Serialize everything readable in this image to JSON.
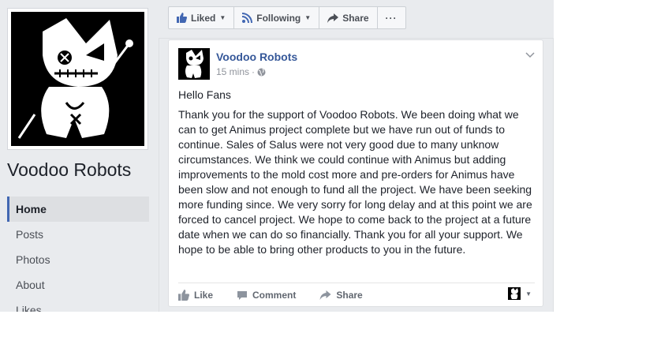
{
  "page": {
    "name": "Voodoo Robots"
  },
  "nav": {
    "items": [
      {
        "label": "Home",
        "active": true
      },
      {
        "label": "Posts",
        "active": false
      },
      {
        "label": "Photos",
        "active": false
      },
      {
        "label": "About",
        "active": false
      },
      {
        "label": "Likes",
        "active": false
      }
    ]
  },
  "actions": {
    "liked_label": "Liked",
    "following_label": "Following",
    "share_label": "Share",
    "more_icon": "ellipsis-icon"
  },
  "post": {
    "author": "Voodoo Robots",
    "time": "15 mins",
    "separator": "·",
    "audience_icon": "globe-icon",
    "greeting": "Hello Fans",
    "message": "Thank you for the support of Voodoo Robots. We been doing what we can to get Animus project complete but we have run out of funds to continue. Sales of Salus were not very good due to many unknow circumstances. We think we could continue with Animus but adding improvements to the mold cost more and pre-orders for Animus have been slow and not enough to fund all the project. We have been seeking more funding since. We very sorry for long delay and at this point we are forced to cancel project. We hope to come back to the project at a future date when we can do so financially. Thank you for all your support. We hope to be able to bring other products to you in the future.",
    "footer": {
      "like_label": "Like",
      "comment_label": "Comment",
      "share_label": "Share"
    }
  },
  "colors": {
    "link_blue": "#365899",
    "accent_blue": "#4267b2",
    "page_bg": "#e9ebee"
  }
}
